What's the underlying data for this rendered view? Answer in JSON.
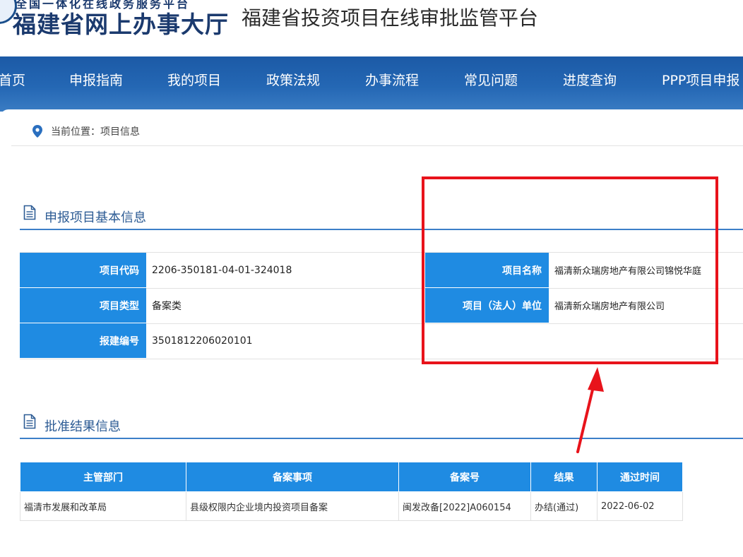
{
  "header": {
    "logo_small": "全国一体化在线政务服务平台",
    "logo_big": "福建省网上办事大厅",
    "platform_title": "福建省投资项目在线审批监管平台"
  },
  "nav": {
    "items": [
      "首页",
      "申报指南",
      "我的项目",
      "政策法规",
      "办事流程",
      "常见问题",
      "进度查询",
      "PPP项目申报"
    ]
  },
  "breadcrumb": {
    "icon": "location-pin-icon",
    "text": "当前位置：项目信息"
  },
  "section_basic": {
    "title": "申报项目基本信息",
    "icon": "document-icon",
    "rows": [
      {
        "label1": "项目代码",
        "value1": "2206-350181-04-01-324018",
        "label2": "项目名称",
        "value2": "福清新众瑞房地产有限公司锦悦华庭"
      },
      {
        "label1": "项目类型",
        "value1": "备案类",
        "label2": "项目（法人）单位",
        "value2": "福清新众瑞房地产有限公司"
      },
      {
        "label1": "报建编号",
        "value1": "3501812206020101"
      }
    ]
  },
  "section_approval": {
    "title": "批准结果信息",
    "icon": "document-icon",
    "headers": [
      "主管部门",
      "备案事项",
      "备案号",
      "结果",
      "通过时间"
    ],
    "rows": [
      [
        "福清市发展和改革局",
        "县级权限内企业境内投资项目备案",
        "闽发改备[2022]A060154",
        "办结(通过)",
        "2022-06-02"
      ]
    ]
  },
  "colors": {
    "nav_bg": "#2467b4",
    "label_bg": "#1f8be2",
    "section_line": "#3c7fc8",
    "annotation": "#e8131b"
  }
}
